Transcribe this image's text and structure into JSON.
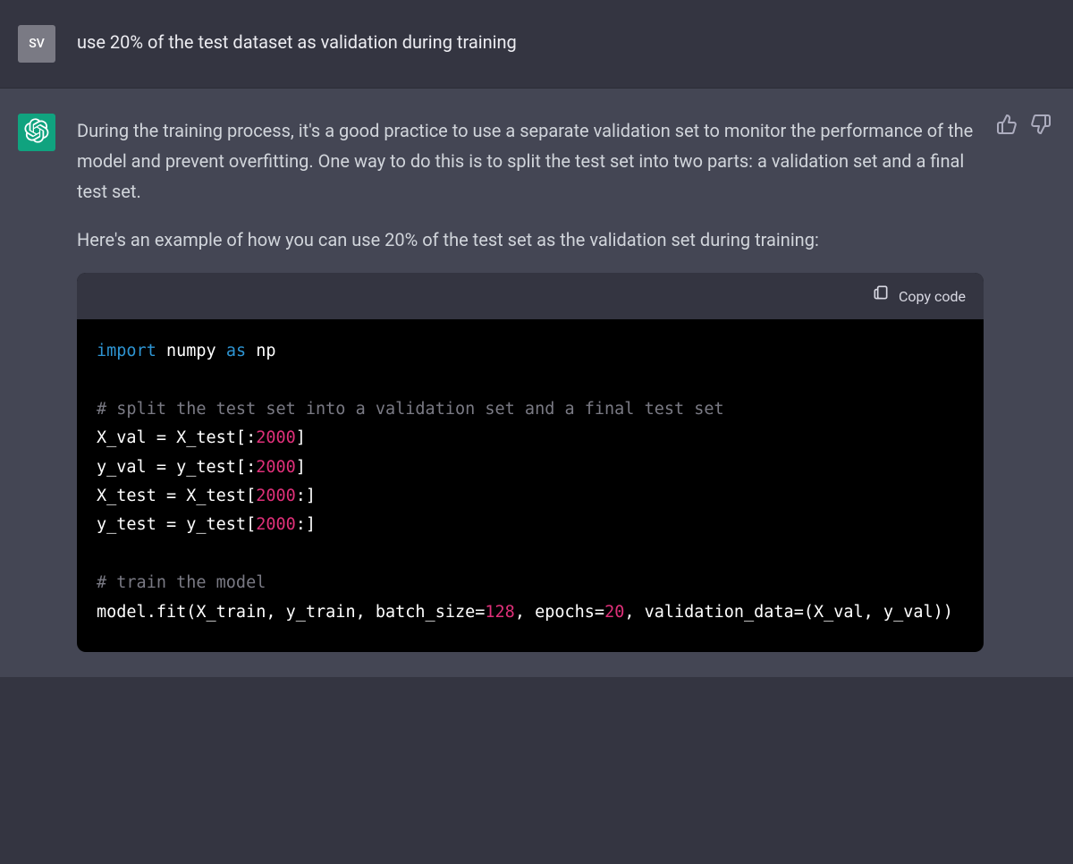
{
  "user": {
    "avatar_initials": "SV",
    "message": "use 20% of the test dataset as validation during training"
  },
  "assistant": {
    "paragraph1": "During the training process, it's a good practice to use a separate validation set to monitor the performance of the model and prevent overfitting. One way to do this is to split the test set into two parts: a validation set and a final test set.",
    "paragraph2": "Here's an example of how you can use 20% of the test set as the validation set during training:"
  },
  "code": {
    "copy_label": "Copy code",
    "kw_import": "import",
    "mod_numpy": "numpy",
    "kw_as": "as",
    "alias_np": "np",
    "comment1": "# split the test set into a validation set and a final test set",
    "line_xval_a": "X_val = X_test[:",
    "num_2000_1": "2000",
    "line_xval_b": "]",
    "line_yval_a": "y_val = y_test[:",
    "num_2000_2": "2000",
    "line_yval_b": "]",
    "line_xtest_a": "X_test = X_test[",
    "num_2000_3": "2000",
    "line_xtest_b": ":]",
    "line_ytest_a": "y_test = y_test[",
    "num_2000_4": "2000",
    "line_ytest_b": ":]",
    "comment2": "# train the model",
    "fit_a": "model.fit(X_train, y_train, batch_size=",
    "num_128": "128",
    "fit_b": ", epochs=",
    "num_20": "20",
    "fit_c": ", validation_data=(X_val, y_val))"
  }
}
